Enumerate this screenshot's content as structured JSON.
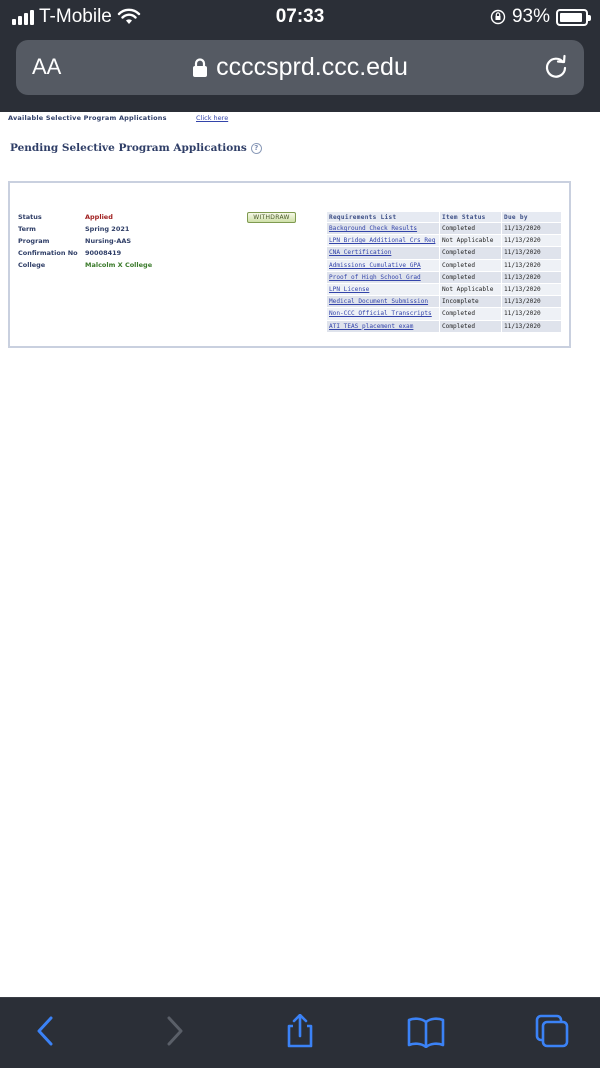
{
  "status_bar": {
    "carrier": "T-Mobile",
    "time": "07:33",
    "battery_percent": "93%",
    "battery_level": 0.93
  },
  "browser": {
    "text_size_button": "AA",
    "url": "ccccsprd.ccc.edu"
  },
  "page": {
    "top_row_label": "Available Selective Program Applications",
    "top_row_link": "Click here",
    "heading": "Pending Selective Program Applications",
    "help_icon_text": "?",
    "application": {
      "fields": [
        {
          "label": "Status",
          "value": "Applied"
        },
        {
          "label": "Term",
          "value": "Spring 2021"
        },
        {
          "label": "Program",
          "value": "Nursing-AAS"
        },
        {
          "label": "Confirmation No",
          "value": "90008419"
        },
        {
          "label": "College",
          "value": "Malcolm X College"
        }
      ],
      "withdraw_label": "WITHDRAW",
      "requirements_table": {
        "headers": [
          "Requirements List",
          "Item Status",
          "Due by"
        ],
        "rows": [
          {
            "name": "Background Check Results",
            "status": "Completed",
            "due": "11/13/2020"
          },
          {
            "name": "LPN Bridge Additional Crs Req",
            "status": "Not Applicable",
            "due": "11/13/2020"
          },
          {
            "name": "CNA Certification",
            "status": "Completed",
            "due": "11/13/2020"
          },
          {
            "name": "Admissions Cumulative GPA",
            "status": "Completed",
            "due": "11/13/2020"
          },
          {
            "name": "Proof of High School Grad",
            "status": "Completed",
            "due": "11/13/2020"
          },
          {
            "name": "LPN License",
            "status": "Not Applicable",
            "due": "11/13/2020"
          },
          {
            "name": "Medical Document Submission",
            "status": "Incomplete",
            "due": "11/13/2020"
          },
          {
            "name": "Non-CCC Official Transcripts",
            "status": "Completed",
            "due": "11/13/2020"
          },
          {
            "name": "ATI TEAS placement exam",
            "status": "Completed",
            "due": "11/13/2020"
          }
        ]
      }
    }
  },
  "colors": {
    "chrome": "#2b2f37",
    "accent_blue": "#3b82f6",
    "status_applied": "#a02020",
    "college_green": "#3a7a2a"
  },
  "toolbar_icons": [
    "back-icon",
    "forward-icon",
    "share-icon",
    "bookmarks-icon",
    "tabs-icon"
  ]
}
